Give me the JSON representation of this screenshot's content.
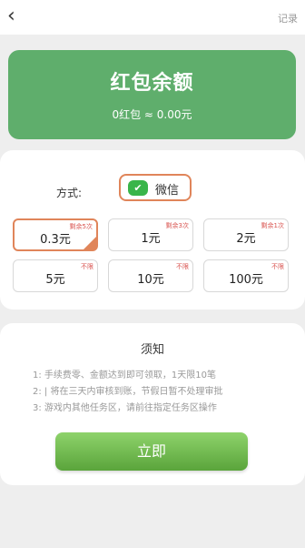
{
  "header": {
    "back_icon": "chevron-left-icon",
    "back_glyph": "‹",
    "record_label": "记录"
  },
  "balance": {
    "title": "红包余额",
    "subtitle": "0红包 ≈ 0.00元",
    "color": "#5fae6c"
  },
  "payment": {
    "method_label": "方式:",
    "wechat_label": "微信",
    "wechat_icon": "wechat-icon"
  },
  "options": [
    {
      "value": "0.3元",
      "tag": "剩余5次",
      "selected": true
    },
    {
      "value": "1元",
      "tag": "剩余3次",
      "selected": false
    },
    {
      "value": "2元",
      "tag": "剩余1次",
      "selected": false
    },
    {
      "value": "5元",
      "tag": "不限",
      "selected": false
    },
    {
      "value": "10元",
      "tag": "不限",
      "selected": false
    },
    {
      "value": "100元",
      "tag": "不限",
      "selected": false
    }
  ],
  "notice": {
    "title": "须知",
    "rules": [
      "1:      手续费零、金额达到即可领取，1天限10笔",
      "2:  |      将在三天内审核到账，节假日暂不处理审批",
      "3:  游戏内其他任务区，请前往指定任务区操作"
    ]
  },
  "withdraw_button": {
    "label": "立即"
  },
  "colors": {
    "accent": "#e0855a",
    "button": "#6cb84a"
  }
}
